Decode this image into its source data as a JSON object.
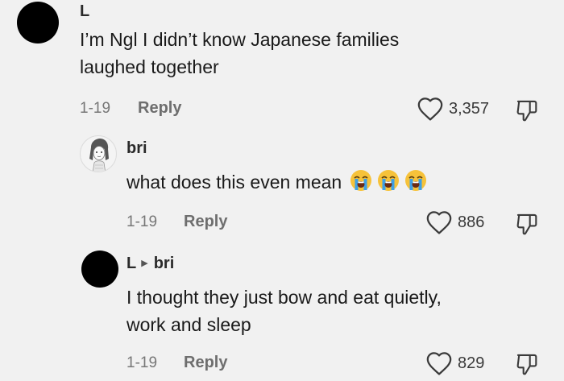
{
  "comments": [
    {
      "author": "L",
      "reply_to": "",
      "text_lines": [
        "I’m Ngl I didn’t know Japanese families",
        "laughed together"
      ],
      "date": "1-19",
      "reply_label": "Reply",
      "likes": "3,357",
      "avatar": "black-circle"
    },
    {
      "author": "bri",
      "reply_to": "",
      "text_lines": [
        "what does this even mean"
      ],
      "emojis": [
        "loudly-crying-face",
        "loudly-crying-face",
        "loudly-crying-face"
      ],
      "date": "1-19",
      "reply_label": "Reply",
      "likes": "886",
      "avatar": "sketch-portrait"
    },
    {
      "author": "L",
      "reply_to": "bri",
      "text_lines": [
        "I thought they just bow and eat quietly,",
        "work and sleep"
      ],
      "date": "1-19",
      "reply_label": "Reply",
      "likes": "829",
      "avatar": "black-circle"
    }
  ],
  "icons": {
    "like": "heart-outline-icon",
    "dislike": "thumbs-down-outline-icon",
    "reply_arrow": "triangle-right-icon"
  },
  "colors": {
    "background": "#f1f1f1",
    "text": "#1a1a1a",
    "secondary": "#777777",
    "emoji": "#f6c23a",
    "tears": "#3ea0e6"
  }
}
